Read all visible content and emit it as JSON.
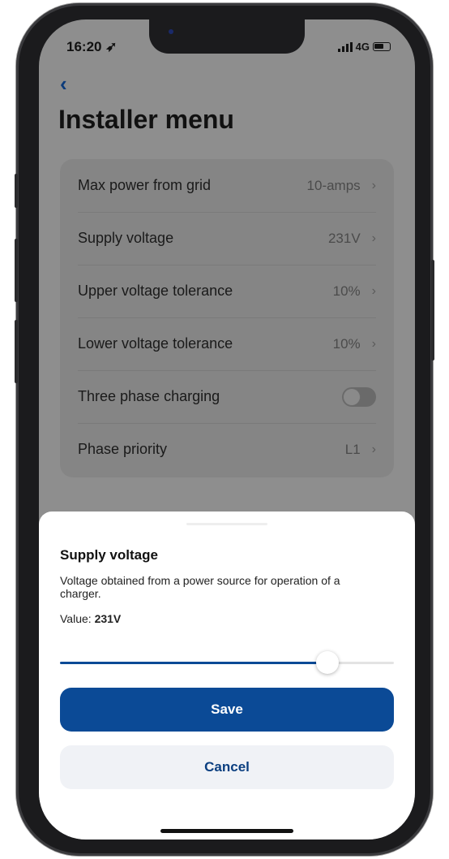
{
  "status_bar": {
    "time": "16:20",
    "network": "4G"
  },
  "header": {
    "title": "Installer menu"
  },
  "settings": [
    {
      "label": "Max power from grid",
      "value": "10-amps",
      "type": "chevron"
    },
    {
      "label": "Supply voltage",
      "value": "231V",
      "type": "chevron"
    },
    {
      "label": "Upper voltage tolerance",
      "value": "10%",
      "type": "chevron"
    },
    {
      "label": "Lower voltage tolerance",
      "value": "10%",
      "type": "chevron"
    },
    {
      "label": "Three phase charging",
      "value": "",
      "type": "toggle",
      "enabled": false
    },
    {
      "label": "Phase priority",
      "value": "L1",
      "type": "chevron"
    }
  ],
  "sheet": {
    "title": "Supply voltage",
    "description": "Voltage obtained from a power source for operation of a charger.",
    "value_label": "Value:",
    "value": "231V",
    "slider_fraction": 0.8,
    "save_label": "Save",
    "cancel_label": "Cancel"
  },
  "colors": {
    "accent": "#0b4a96",
    "cancel_bg": "#f0f2f6",
    "overlay": "#8e8e8e"
  }
}
